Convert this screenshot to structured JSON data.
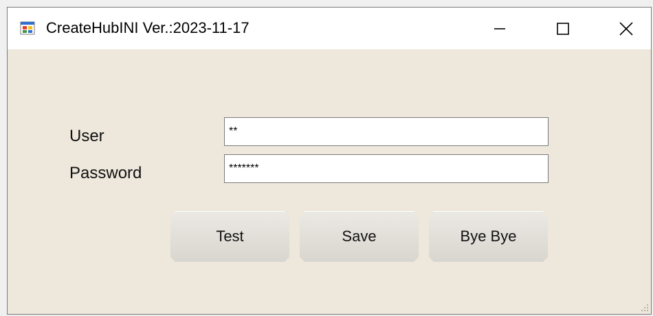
{
  "window": {
    "title": "CreateHubINI Ver.:2023-11-17",
    "icon": "app-form-icon",
    "controls": {
      "minimize": "minimize-icon",
      "maximize": "maximize-icon",
      "close": "close-icon"
    }
  },
  "form": {
    "user_label": "User",
    "user_value": "**",
    "password_label": "Password",
    "password_value": "*******"
  },
  "buttons": {
    "test": "Test",
    "save": "Save",
    "bye": "Bye Bye"
  }
}
